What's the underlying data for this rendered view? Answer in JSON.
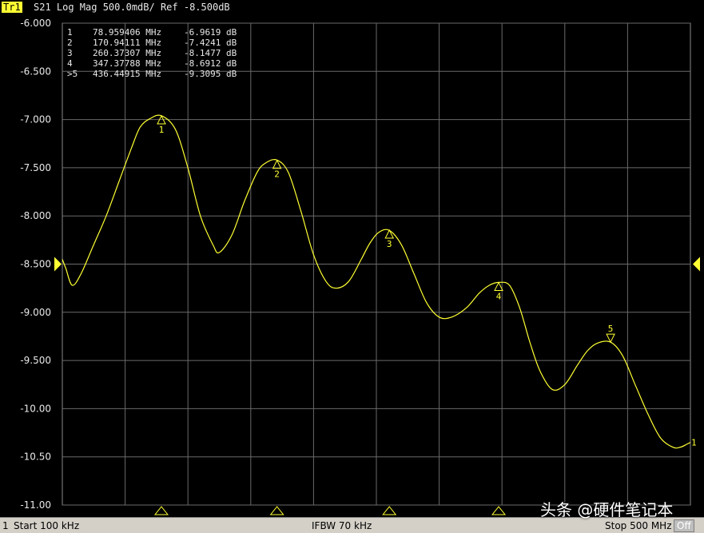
{
  "header": {
    "trace_label": "Tr1",
    "title": "S21 Log Mag 500.0mdB/ Ref -8.500dB"
  },
  "colors": {
    "trace": "#ffff33",
    "grid": "#6a6a6a",
    "text": "#e8e8e8",
    "background": "#000000"
  },
  "footer": {
    "channel": "1",
    "start": "Start 100 kHz",
    "ifbw": "IFBW 70 kHz",
    "stop": "Stop 500 MHz",
    "off_label": "Off"
  },
  "watermark": "头条 @硬件笔记本",
  "chart_data": {
    "type": "line",
    "title": "S21 Log Mag 500.0mdB/ Ref -8.500dB",
    "xlabel": "",
    "ylabel": "",
    "xunit": "MHz",
    "yunit": "dB",
    "xlim": [
      0.1,
      500
    ],
    "ylim": [
      -11.0,
      -6.0
    ],
    "y_ticks": [
      -6.0,
      -6.5,
      -7.0,
      -7.5,
      -8.0,
      -8.5,
      -9.0,
      -9.5,
      -10.0,
      -10.5,
      -11.0
    ],
    "y_tick_labels": [
      "-6.000",
      "-6.500",
      "-7.000",
      "-7.500",
      "-8.000",
      "-8.500",
      "-9.000",
      "-9.500",
      "-10.00",
      "-10.50",
      "-11.00"
    ],
    "x_divisions": 10,
    "reference_level": -8.5,
    "grid": true,
    "series": [
      {
        "x": [
          0.1,
          3,
          8,
          15,
          25,
          35,
          45,
          55,
          62,
          70,
          78.96,
          90,
          100,
          110,
          120,
          125,
          135,
          145,
          155,
          162,
          170.94,
          180,
          190,
          200,
          210,
          218,
          228,
          238,
          245,
          252,
          260.37,
          270,
          280,
          290,
          300,
          310,
          322,
          332,
          340,
          347.38,
          356,
          364,
          372,
          380,
          390,
          400,
          410,
          418,
          426,
          436.45,
          446,
          456,
          466,
          476,
          486,
          492,
          497,
          500
        ],
        "y": [
          -8.45,
          -8.55,
          -8.72,
          -8.6,
          -8.3,
          -8.0,
          -7.65,
          -7.3,
          -7.08,
          -6.99,
          -6.96,
          -7.1,
          -7.5,
          -8.0,
          -8.3,
          -8.38,
          -8.2,
          -7.85,
          -7.55,
          -7.45,
          -7.42,
          -7.55,
          -7.95,
          -8.4,
          -8.68,
          -8.75,
          -8.68,
          -8.45,
          -8.28,
          -8.17,
          -8.15,
          -8.3,
          -8.6,
          -8.9,
          -9.05,
          -9.05,
          -8.95,
          -8.8,
          -8.72,
          -8.69,
          -8.72,
          -8.95,
          -9.3,
          -9.6,
          -9.8,
          -9.75,
          -9.55,
          -9.4,
          -9.32,
          -9.31,
          -9.45,
          -9.75,
          -10.05,
          -10.3,
          -10.4,
          -10.4,
          -10.37,
          -10.35
        ]
      }
    ],
    "markers": [
      {
        "id": "1",
        "prefix": " ",
        "x": 78.959406,
        "freq": "78.959406 MHz",
        "value": "-6.9619 dB",
        "y": -6.9619,
        "direction": "up"
      },
      {
        "id": "2",
        "prefix": " ",
        "x": 170.94111,
        "freq": "170.94111 MHz",
        "value": "-7.4241 dB",
        "y": -7.4241,
        "direction": "up"
      },
      {
        "id": "3",
        "prefix": " ",
        "x": 260.37307,
        "freq": "260.37307 MHz",
        "value": "-8.1477 dB",
        "y": -8.1477,
        "direction": "up"
      },
      {
        "id": "4",
        "prefix": " ",
        "x": 347.37788,
        "freq": "347.37788 MHz",
        "value": "-8.6912 dB",
        "y": -8.6912,
        "direction": "up"
      },
      {
        "id": "5",
        "prefix": ">",
        "x": 436.44915,
        "freq": "436.44915 MHz",
        "value": "-9.3095 dB",
        "y": -9.3095,
        "direction": "down"
      }
    ],
    "end_label": "1"
  }
}
